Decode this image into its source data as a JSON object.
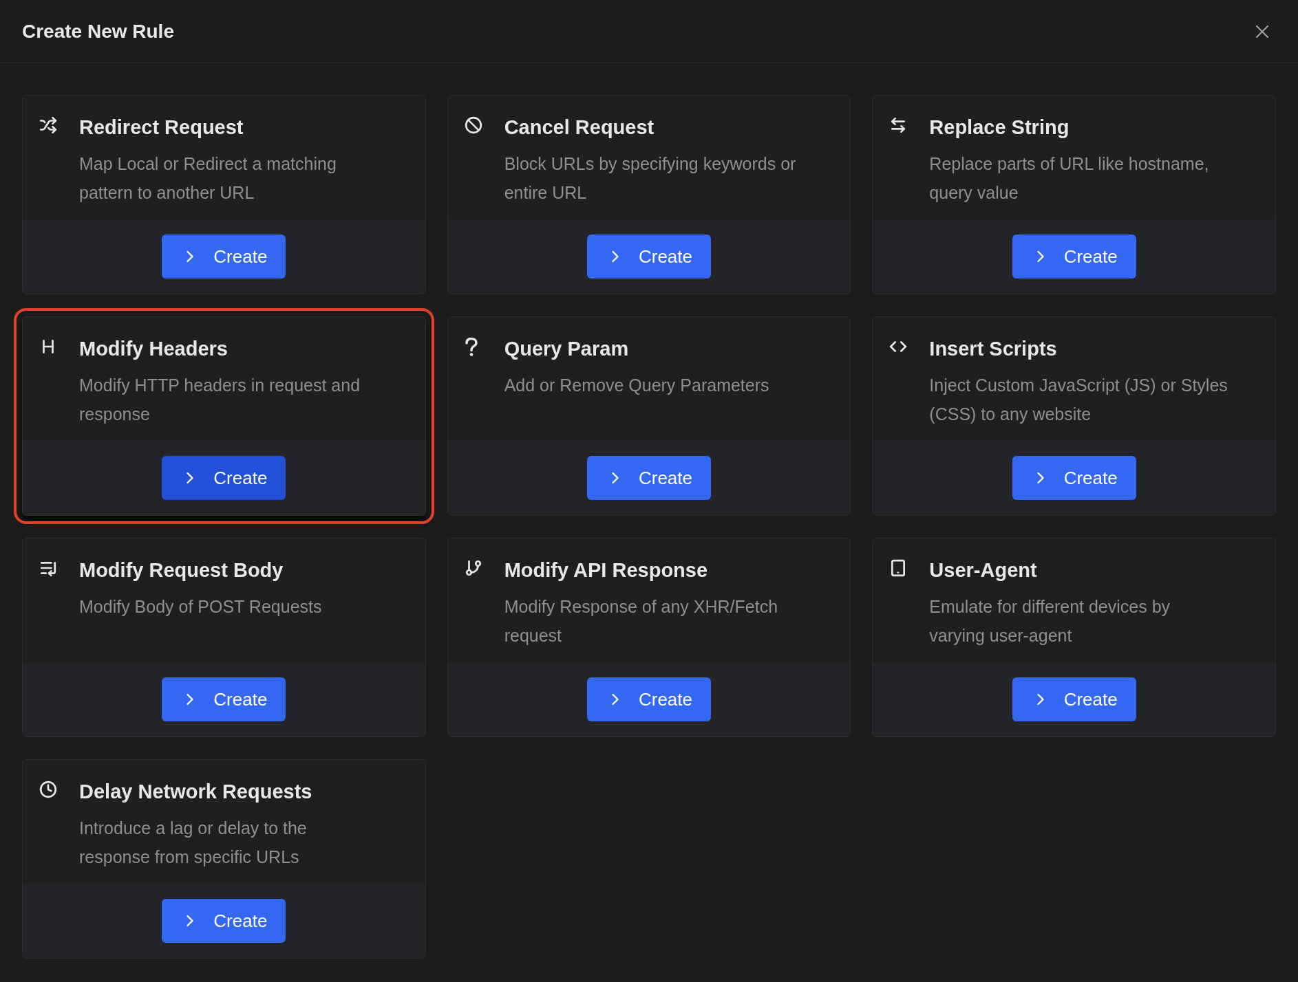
{
  "dialog": {
    "title": "Create New Rule"
  },
  "cards": [
    {
      "kind": "shuffle",
      "title": "Redirect Request",
      "description": "Map Local or Redirect a matching pattern to another URL",
      "button": "Create",
      "selected": false
    },
    {
      "kind": "ban",
      "title": "Cancel Request",
      "description": "Block URLs by specifying keywords or entire URL",
      "button": "Create",
      "selected": false
    },
    {
      "kind": "swap",
      "title": "Replace String",
      "description": "Replace parts of URL like hostname, query value",
      "button": "Create",
      "selected": false
    },
    {
      "kind": "heading",
      "title": "Modify Headers",
      "description": "Modify HTTP headers in request and response",
      "button": "Create",
      "selected": true
    },
    {
      "kind": "question",
      "title": "Query Param",
      "description": "Add or Remove Query Parameters",
      "button": "Create",
      "selected": false
    },
    {
      "kind": "code",
      "title": "Insert Scripts",
      "description": "Inject Custom JavaScript (JS) or Styles (CSS) to any website",
      "button": "Create",
      "selected": false
    },
    {
      "kind": "edit-lines",
      "title": "Modify Request Body",
      "description": "Modify Body of POST Requests",
      "button": "Create",
      "selected": false
    },
    {
      "kind": "branch",
      "title": "Modify API Response",
      "description": "Modify Response of any XHR/Fetch request",
      "button": "Create",
      "selected": false
    },
    {
      "kind": "tablet",
      "title": "User-Agent",
      "description": "Emulate for different devices by varying user-agent",
      "button": "Create",
      "selected": false
    },
    {
      "kind": "clock",
      "title": "Delay Network Requests",
      "description": "Introduce a lag or delay to the response from specific URLs",
      "button": "Create",
      "selected": false
    }
  ]
}
